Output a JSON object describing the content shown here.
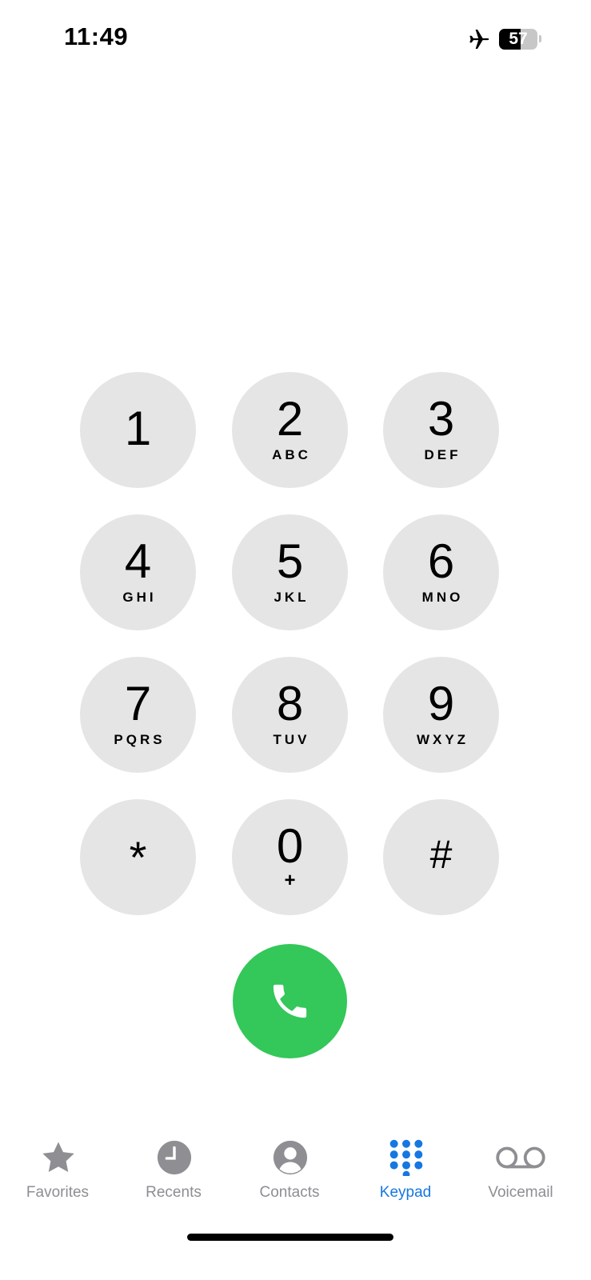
{
  "status_bar": {
    "time": "11:49",
    "battery_level": "57",
    "airplane_icon": "airplane-icon"
  },
  "keypad": {
    "keys": [
      {
        "digit": "1",
        "letters": ""
      },
      {
        "digit": "2",
        "letters": "ABC"
      },
      {
        "digit": "3",
        "letters": "DEF"
      },
      {
        "digit": "4",
        "letters": "GHI"
      },
      {
        "digit": "5",
        "letters": "JKL"
      },
      {
        "digit": "6",
        "letters": "MNO"
      },
      {
        "digit": "7",
        "letters": "PQRS"
      },
      {
        "digit": "8",
        "letters": "TUV"
      },
      {
        "digit": "9",
        "letters": "WXYZ"
      },
      {
        "digit": "*",
        "letters": ""
      },
      {
        "digit": "0",
        "letters": "+"
      },
      {
        "digit": "#",
        "letters": ""
      }
    ],
    "call_icon": "phone-icon",
    "key_color": "#e5e5e5",
    "call_color": "#34c759"
  },
  "tab_bar": {
    "tabs": [
      {
        "label": "Favorites",
        "icon": "star-icon",
        "active": false
      },
      {
        "label": "Recents",
        "icon": "clock-icon",
        "active": false
      },
      {
        "label": "Contacts",
        "icon": "person-icon",
        "active": false
      },
      {
        "label": "Keypad",
        "icon": "keypad-icon",
        "active": true
      },
      {
        "label": "Voicemail",
        "icon": "voicemail-icon",
        "active": false
      }
    ],
    "active_color": "#1577e2",
    "inactive_color": "#8e8e93"
  }
}
